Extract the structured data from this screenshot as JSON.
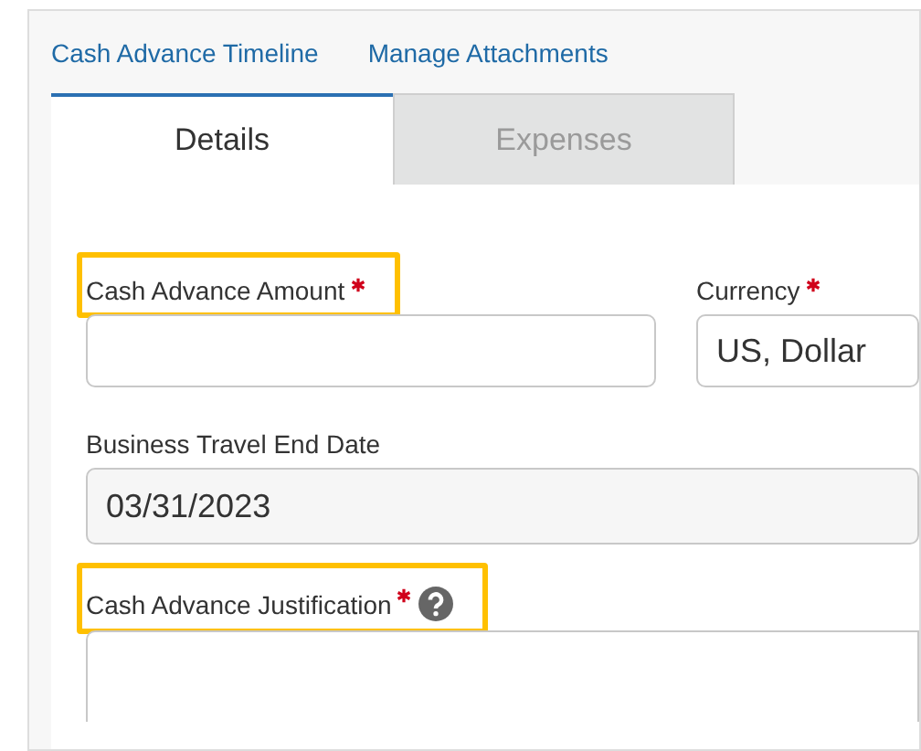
{
  "links": [
    {
      "label": "Cash Advance Timeline"
    },
    {
      "label": "Manage Attachments"
    }
  ],
  "tabs": [
    {
      "label": "Details",
      "selected": true
    },
    {
      "label": "Expenses",
      "selected": false
    }
  ],
  "rows": [
    {
      "fields": [
        {
          "kind": "text",
          "label": "Cash Advance Amount",
          "required": true,
          "highlighted": true
        },
        {
          "kind": "select",
          "label": "Currency",
          "required": true,
          "highlighted": false,
          "value": "US, Dollar"
        }
      ]
    },
    {
      "fields": [
        {
          "kind": "readonly",
          "label": "Business Travel End Date",
          "required": false,
          "highlighted": false,
          "value": "03/31/2023"
        }
      ]
    },
    {
      "fields": [
        {
          "kind": "textarea",
          "label": "Cash Advance Justification",
          "required": true,
          "highlighted": true,
          "help": true
        }
      ]
    }
  ]
}
